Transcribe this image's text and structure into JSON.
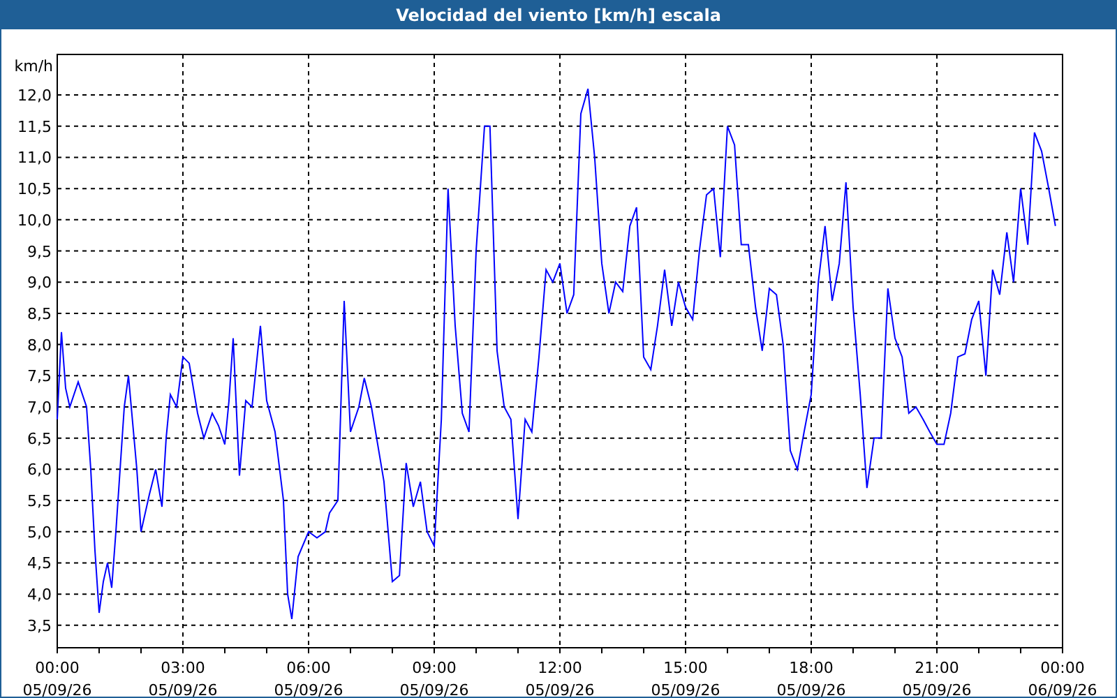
{
  "window": {
    "title": "Velocidad del viento [km/h] escala"
  },
  "chart": {
    "chart_data": {
      "type": "line",
      "grid": true,
      "ylabel": "km/h",
      "xlim": [
        0,
        24
      ],
      "ylim": [
        3.14,
        12.65
      ],
      "x": [
        0,
        0.1,
        0.2,
        0.3,
        0.5,
        0.7,
        0.8,
        0.9,
        1.0,
        1.1,
        1.2,
        1.3,
        1.4,
        1.6,
        1.7,
        1.9,
        2.0,
        2.2,
        2.35,
        2.5,
        2.6,
        2.7,
        2.85,
        3.0,
        3.15,
        3.35,
        3.5,
        3.7,
        3.85,
        4.0,
        4.1,
        4.2,
        4.35,
        4.5,
        4.65,
        4.85,
        5.0,
        5.2,
        5.4,
        5.5,
        5.6,
        5.75,
        6.0,
        6.2,
        6.4,
        6.5,
        6.7,
        6.85,
        7.0,
        7.2,
        7.33,
        7.5,
        7.8,
        8.0,
        8.17,
        8.33,
        8.5,
        8.67,
        8.83,
        9.0,
        9.17,
        9.33,
        9.5,
        9.67,
        9.83,
        10.0,
        10.2,
        10.33,
        10.5,
        10.67,
        10.83,
        11.0,
        11.17,
        11.33,
        11.5,
        11.67,
        11.83,
        12.0,
        12.17,
        12.33,
        12.5,
        12.67,
        12.83,
        13.0,
        13.17,
        13.33,
        13.5,
        13.67,
        13.83,
        14.0,
        14.17,
        14.33,
        14.5,
        14.67,
        14.83,
        15.0,
        15.17,
        15.33,
        15.5,
        15.67,
        15.83,
        16.0,
        16.17,
        16.33,
        16.5,
        16.67,
        16.83,
        17.0,
        17.17,
        17.33,
        17.5,
        17.67,
        17.83,
        18.0,
        18.17,
        18.33,
        18.5,
        18.67,
        18.83,
        19.0,
        19.17,
        19.33,
        19.5,
        19.67,
        19.83,
        20.0,
        20.17,
        20.33,
        20.5,
        20.67,
        20.83,
        21.0,
        21.17,
        21.33,
        21.5,
        21.67,
        21.83,
        22.0,
        22.17,
        22.33,
        22.5,
        22.67,
        22.83,
        23.0,
        23.17,
        23.33,
        23.5,
        23.67,
        23.83
      ],
      "series": [
        {
          "color": "#0000ff",
          "values": [
            6.8,
            8.2,
            7.3,
            7.0,
            7.4,
            7.0,
            6.0,
            4.7,
            3.7,
            4.2,
            4.5,
            4.1,
            5.0,
            7.0,
            7.5,
            6.0,
            5.0,
            5.6,
            6.0,
            5.4,
            6.5,
            7.2,
            7.0,
            7.8,
            7.7,
            6.9,
            6.5,
            6.9,
            6.7,
            6.4,
            7.1,
            8.1,
            5.9,
            7.1,
            7.0,
            8.3,
            7.1,
            6.6,
            5.5,
            4.0,
            3.6,
            4.6,
            5.0,
            4.9,
            5.0,
            5.3,
            5.5,
            8.7,
            6.6,
            7.0,
            7.46,
            7.0,
            5.8,
            4.2,
            4.3,
            6.1,
            5.4,
            5.8,
            5.0,
            4.77,
            6.8,
            10.5,
            8.3,
            6.9,
            6.6,
            9.5,
            11.5,
            11.5,
            7.9,
            7.0,
            6.8,
            5.2,
            6.8,
            6.6,
            7.8,
            9.2,
            9.0,
            9.3,
            8.5,
            8.8,
            11.7,
            12.1,
            11.0,
            9.3,
            8.5,
            9.0,
            8.85,
            9.9,
            10.2,
            7.8,
            7.6,
            8.3,
            9.2,
            8.3,
            9.0,
            8.6,
            8.4,
            9.5,
            10.4,
            10.5,
            9.4,
            11.5,
            11.2,
            9.6,
            9.6,
            8.6,
            7.9,
            8.9,
            8.8,
            8.0,
            6.3,
            6.0,
            6.6,
            7.2,
            9.0,
            9.9,
            8.7,
            9.3,
            10.6,
            8.6,
            7.2,
            5.7,
            6.5,
            6.5,
            8.9,
            8.1,
            7.8,
            6.9,
            7.0,
            6.8,
            6.6,
            6.4,
            6.4,
            6.9,
            7.8,
            7.85,
            8.4,
            8.7,
            7.5,
            9.2,
            8.8,
            9.8,
            9.0,
            10.5,
            9.6,
            11.4,
            11.1,
            10.5,
            9.9
          ]
        }
      ],
      "xticks": [
        {
          "value": 0,
          "label": "00:00"
        },
        {
          "value": 3,
          "label": "03:00"
        },
        {
          "value": 6,
          "label": "06:00"
        },
        {
          "value": 9,
          "label": "09:00"
        },
        {
          "value": 12,
          "label": "12:00"
        },
        {
          "value": 15,
          "label": "15:00"
        },
        {
          "value": 18,
          "label": "18:00"
        },
        {
          "value": 21,
          "label": "21:00"
        },
        {
          "value": 24,
          "label": "00:00"
        }
      ],
      "yticks": [
        {
          "value": 3.5,
          "label": "3,5"
        },
        {
          "value": 4,
          "label": "4,0"
        },
        {
          "value": 4.5,
          "label": "4,5"
        },
        {
          "value": 5,
          "label": "5,0"
        },
        {
          "value": 5.5,
          "label": "5,5"
        },
        {
          "value": 6,
          "label": "6,0"
        },
        {
          "value": 6.5,
          "label": "6,5"
        },
        {
          "value": 7,
          "label": "7,0"
        },
        {
          "value": 7.5,
          "label": "7,5"
        },
        {
          "value": 8,
          "label": "8,0"
        },
        {
          "value": 8.5,
          "label": "8,5"
        },
        {
          "value": 9,
          "label": "9,0"
        },
        {
          "value": 9.5,
          "label": "9,5"
        },
        {
          "value": 10,
          "label": "10,0"
        },
        {
          "value": 10.5,
          "label": "10,5"
        },
        {
          "value": 11,
          "label": "11,0"
        },
        {
          "value": 11.5,
          "label": "11,5"
        },
        {
          "value": 12,
          "label": "12,0"
        }
      ]
    },
    "x_dates": [
      "05/09/26",
      "05/09/26",
      "05/09/26",
      "05/09/26",
      "05/09/26",
      "05/09/26",
      "05/09/26",
      "05/09/26",
      "06/09/26"
    ]
  }
}
